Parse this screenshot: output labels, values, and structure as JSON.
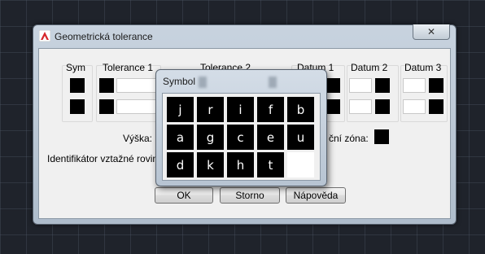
{
  "dialog": {
    "title": "Geometrická tolerance",
    "close_label": "✕",
    "columns": {
      "sym": "Sym",
      "tol1": "Tolerance 1",
      "tol2": "Tolerance 2",
      "datum1": "Datum 1",
      "datum2": "Datum 2",
      "datum3": "Datum 3"
    },
    "height_label": "Výška:",
    "zone_label": "ční zóna:",
    "datum_id_label": "Identifikátor vztažné roviny:",
    "buttons": {
      "ok": "OK",
      "cancel": "Storno",
      "help": "Nápověda"
    }
  },
  "symbol_popup": {
    "title": "Symbol",
    "symbols": [
      "j",
      "r",
      "i",
      "f",
      "b",
      "a",
      "g",
      "c",
      "e",
      "u",
      "d",
      "k",
      "h",
      "t",
      ""
    ]
  },
  "colors": {
    "accent_red": "#d6262a",
    "background": "#1f232b"
  }
}
